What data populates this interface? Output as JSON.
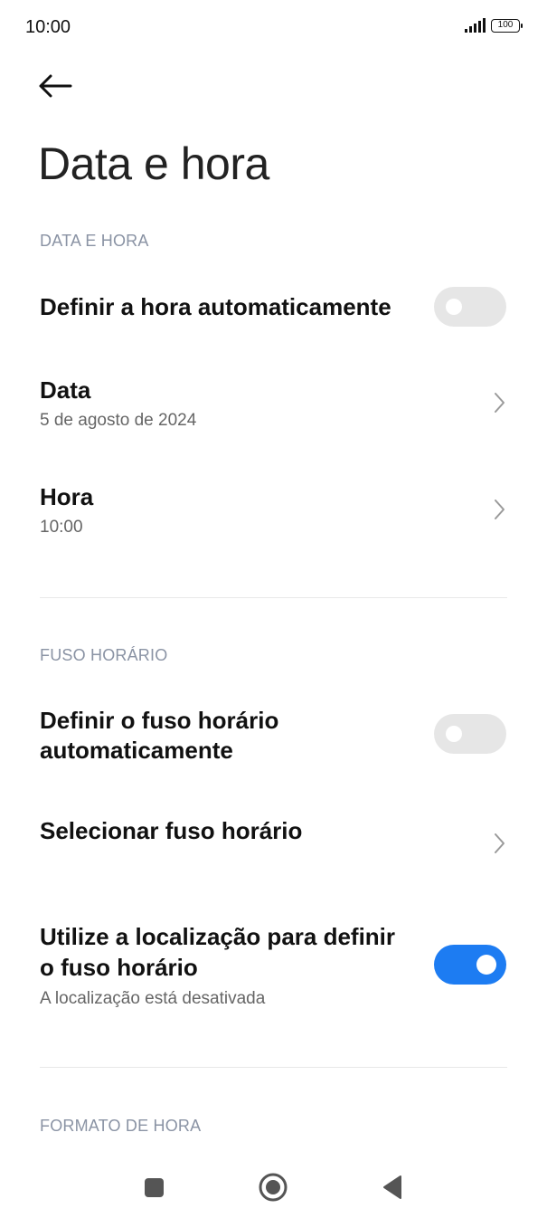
{
  "status_bar": {
    "time": "10:00",
    "battery": "100",
    "icons": [
      "signal-icon",
      "battery-icon"
    ]
  },
  "header": {
    "back_icon": "arrow-left-icon",
    "title": "Data e hora"
  },
  "sections": {
    "date_time": {
      "header": "DATA E HORA",
      "auto_time": {
        "label": "Definir a hora automaticamente",
        "enabled": false
      },
      "date": {
        "label": "Data",
        "value": "5 de agosto de 2024"
      },
      "time": {
        "label": "Hora",
        "value": "10:00"
      }
    },
    "time_zone": {
      "header": "FUSO HORÁRIO",
      "auto_zone": {
        "label_line1": "Definir o fuso horário",
        "label_line2": "automaticamente",
        "enabled": false
      },
      "select_zone": {
        "label": "Selecionar fuso horário"
      },
      "use_location": {
        "label_line1": "Utilize a localização para definir",
        "label_line2": "o fuso horário",
        "subtitle": "A localização está desativada",
        "enabled": true
      }
    },
    "time_format": {
      "header": "FORMATO DE HORA"
    }
  },
  "colors": {
    "accent": "#1d7cf2",
    "toggle_off": "#e6e6e6",
    "section_header": "#8a93a4",
    "subtitle": "#666666"
  },
  "nav_bar": {
    "icons": [
      "square-recents-icon",
      "circle-home-icon",
      "triangle-back-icon"
    ]
  }
}
